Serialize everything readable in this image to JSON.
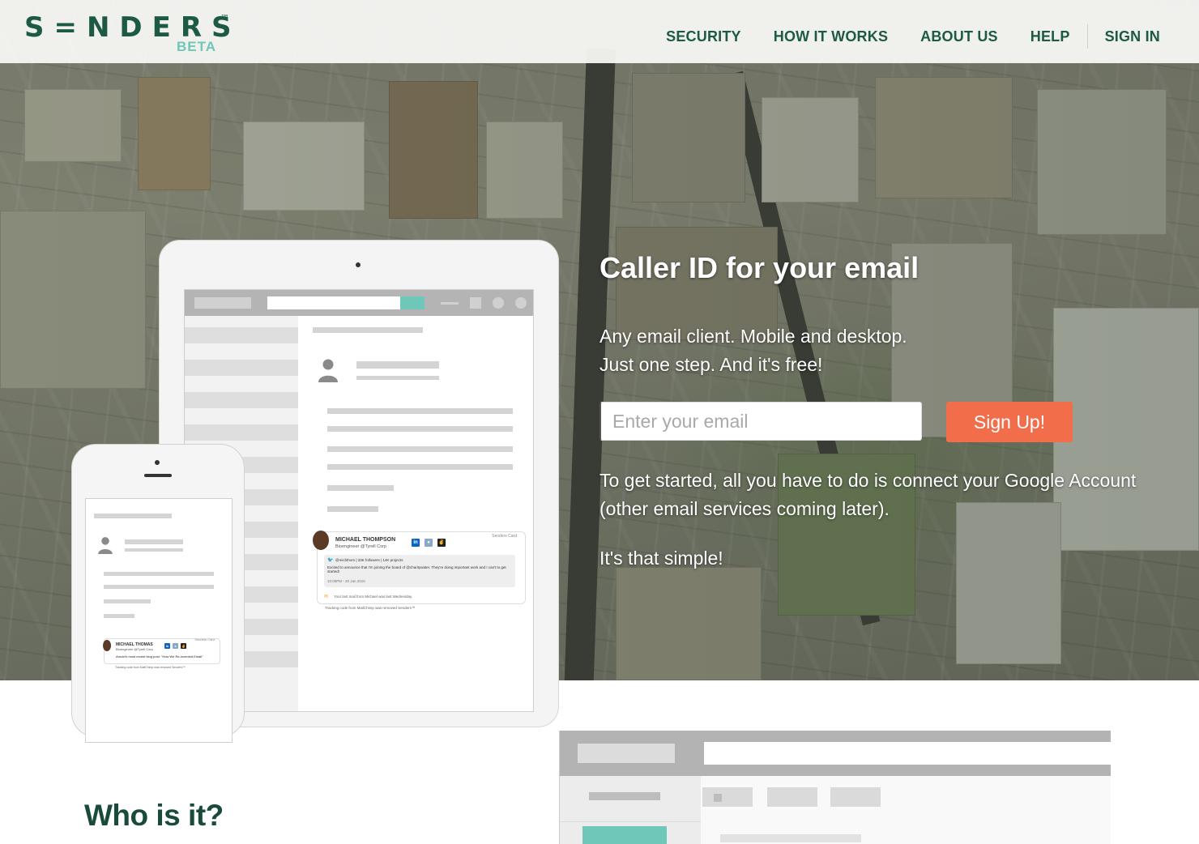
{
  "brand": {
    "logo": "S=NDERS",
    "tm": "™",
    "beta": "BETA"
  },
  "nav": {
    "items": [
      {
        "label": "SECURITY"
      },
      {
        "label": "HOW IT WORKS"
      },
      {
        "label": "ABOUT US"
      },
      {
        "label": "HELP"
      }
    ],
    "sign_in": "SIGN IN"
  },
  "hero": {
    "title": "Caller ID for your email",
    "sub_line1": "Any email client. Mobile and desktop.",
    "sub_line2": "Just one step. And it's free!",
    "email_placeholder": "Enter your email",
    "signup_label": "Sign Up!",
    "body": "To get started, all you have to do is connect your Google Account (other email services coming later).",
    "simple": "It's that simple!"
  },
  "tablet_card": {
    "brand": "Senders Card",
    "name": "MICHAEL THOMPSON",
    "role": "Bioengineer @Tyrell Corp",
    "tweet_handle": "@michthom | 33K followers | 14K projects",
    "tweet_text": "Excited to announce that I'm joining the board of @charitywater. They're doing important work and I can't to get started!",
    "tweet_time": "10:05PM - 20 Jan 2016",
    "last_mail": "Your last mail from Michael was last Wednesday.",
    "tracking": "Tracking code from MailChimp was removed Senders™"
  },
  "phone_card": {
    "brand": "Senders Card",
    "name": "MICHAEL THOMAS",
    "role": "Bioengineer @Tyrell Corp",
    "post": "Arnold's most recent blog post: \"How We Re-invented Email\"",
    "tracking": "Tracking code from MailChimp was removed Senders™"
  },
  "section2": {
    "title": "Who is it?"
  },
  "colors": {
    "brand_green": "#1d5a45",
    "accent_teal": "#6ec7b8",
    "cta_orange": "#f26d4a"
  }
}
